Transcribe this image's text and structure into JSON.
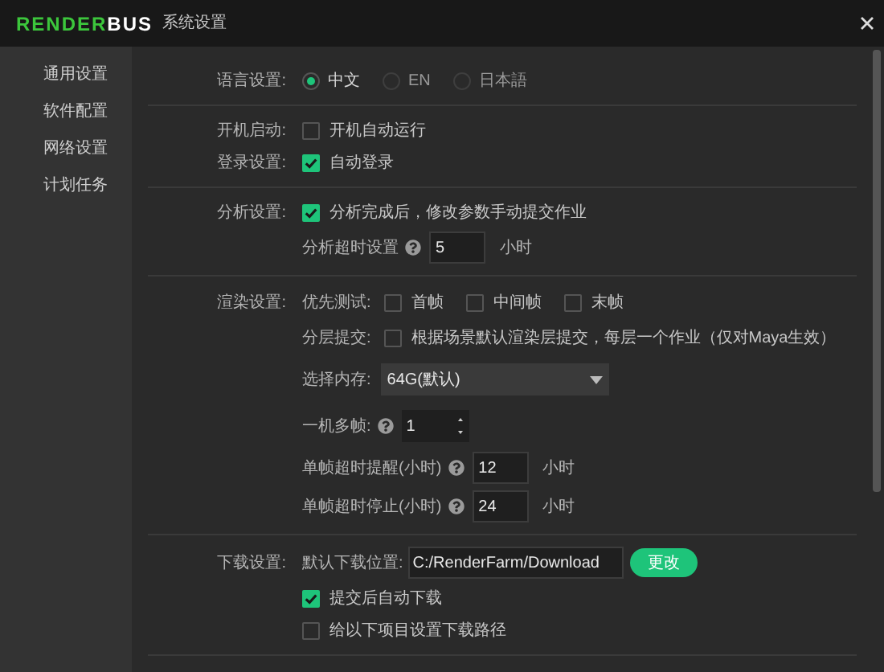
{
  "window": {
    "logo_left": "RENDER",
    "logo_right": "BUS",
    "title": "系统设置"
  },
  "sidebar": {
    "items": [
      {
        "label": "通用设置"
      },
      {
        "label": "软件配置"
      },
      {
        "label": "网络设置"
      },
      {
        "label": "计划任务"
      }
    ]
  },
  "sections": [
    {
      "rows": [
        {
          "kind": "radio",
          "label": "语言设置:",
          "options": [
            {
              "label": "中文",
              "selected": true
            },
            {
              "label": "EN",
              "selected": false
            },
            {
              "label": "日本語",
              "selected": false
            }
          ]
        }
      ]
    },
    {
      "rows": [
        {
          "kind": "checkbox",
          "label": "开机启动:",
          "text": "开机自动运行",
          "checked": false
        },
        {
          "kind": "checkbox",
          "label": "登录设置:",
          "text": "自动登录",
          "checked": true
        }
      ]
    },
    {
      "rows": [
        {
          "kind": "checkbox",
          "label": "分析设置:",
          "text": "分析完成后，修改参数手动提交作业",
          "checked": true
        },
        {
          "kind": "number",
          "field_label": "分析超时设置",
          "help": true,
          "value": "5",
          "unit": "小时"
        }
      ]
    },
    {
      "rows": [
        {
          "kind": "checkbox_group",
          "label": "渲染设置:",
          "field_label": "优先测试:",
          "options": [
            {
              "text": "首帧",
              "checked": false
            },
            {
              "text": "中间帧",
              "checked": false
            },
            {
              "text": "末帧",
              "checked": false
            }
          ]
        },
        {
          "kind": "checkbox_group",
          "field_label": "分层提交:",
          "options": [
            {
              "text": "根据场景默认渲染层提交，每层一个作业（仅对Maya生效）",
              "checked": false
            }
          ]
        },
        {
          "kind": "select",
          "field_label": "选择内存:",
          "value": "64G(默认)"
        },
        {
          "kind": "spinner",
          "field_label": "一机多帧:",
          "help": true,
          "value": "1"
        },
        {
          "kind": "number",
          "field_label": "单帧超时提醒(小时)",
          "help": true,
          "value": "12",
          "unit": "小时"
        },
        {
          "kind": "number",
          "field_label": "单帧超时停止(小时)",
          "help": true,
          "value": "24",
          "unit": "小时"
        }
      ]
    },
    {
      "rows": [
        {
          "kind": "path",
          "label": "下载设置:",
          "field_label": "默认下载位置:",
          "value": "C:/RenderFarm/Download",
          "button": "更改"
        },
        {
          "kind": "checkbox",
          "text": "提交后自动下载",
          "checked": true
        },
        {
          "kind": "checkbox",
          "text": "给以下项目设置下载路径",
          "checked": false
        }
      ]
    }
  ]
}
